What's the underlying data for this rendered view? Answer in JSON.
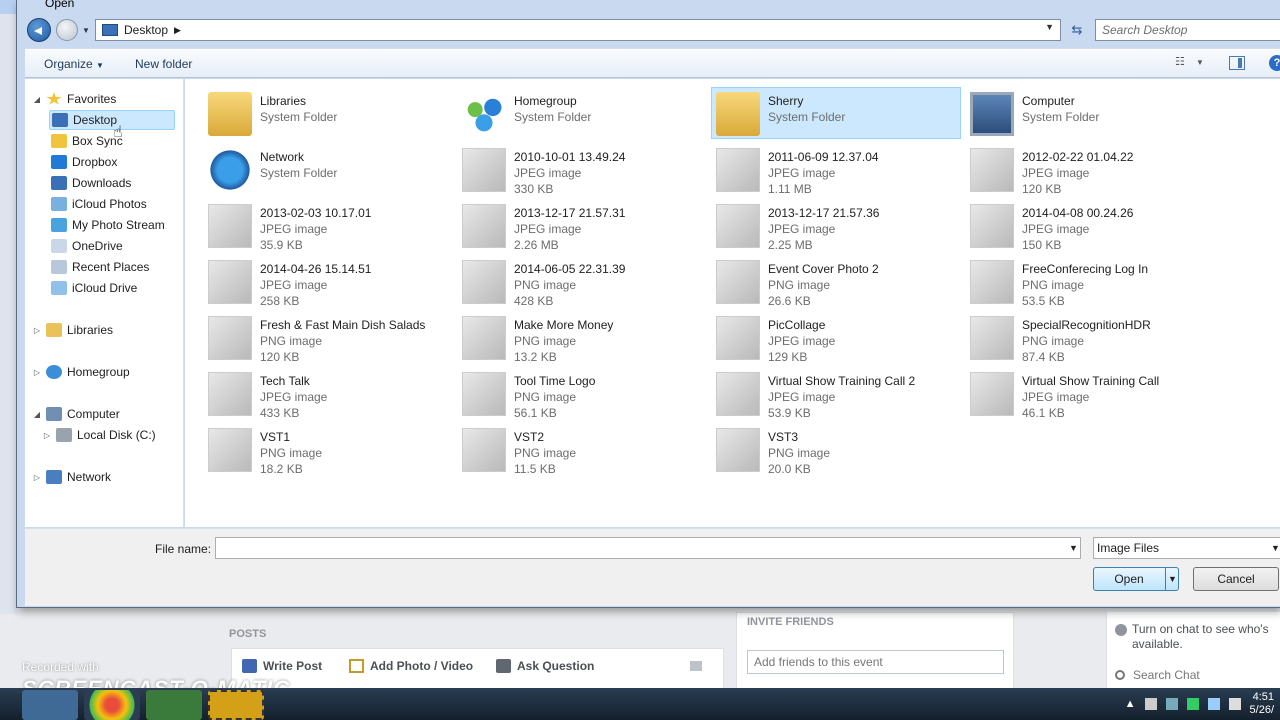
{
  "dialog": {
    "title": "Open",
    "address_path": "Desktop",
    "search_placeholder": "Search Desktop"
  },
  "toolbar": {
    "organize": "Organize",
    "new_folder": "New folder"
  },
  "nav": {
    "favorites": "Favorites",
    "favorite_items": [
      "Desktop",
      "Box Sync",
      "Dropbox",
      "Downloads",
      "iCloud Photos",
      "My Photo Stream",
      "OneDrive",
      "Recent Places",
      "iCloud Drive"
    ],
    "libraries": "Libraries",
    "homegroup": "Homegroup",
    "computer": "Computer",
    "local_disk": "Local Disk (C:)",
    "network": "Network"
  },
  "files": [
    {
      "name": "Libraries",
      "type": "System Folder",
      "size": "",
      "icon": "libraries-icon",
      "selected": false
    },
    {
      "name": "Homegroup",
      "type": "System Folder",
      "size": "",
      "icon": "homegroup-icon",
      "selected": false
    },
    {
      "name": "Sherry",
      "type": "System Folder",
      "size": "",
      "icon": "user-folder-icon",
      "selected": true
    },
    {
      "name": "Computer",
      "type": "System Folder",
      "size": "",
      "icon": "computer-icon",
      "selected": false
    },
    {
      "name": "Network",
      "type": "System Folder",
      "size": "",
      "icon": "network-icon",
      "selected": false
    },
    {
      "name": "2010-10-01 13.49.24",
      "type": "JPEG image",
      "size": "330 KB",
      "icon": "image-thumbnail",
      "selected": false
    },
    {
      "name": "2011-06-09 12.37.04",
      "type": "JPEG image",
      "size": "1.11 MB",
      "icon": "image-thumbnail",
      "selected": false
    },
    {
      "name": "2012-02-22 01.04.22",
      "type": "JPEG image",
      "size": "120 KB",
      "icon": "image-thumbnail",
      "selected": false
    },
    {
      "name": "2013-02-03 10.17.01",
      "type": "JPEG image",
      "size": "35.9 KB",
      "icon": "image-thumbnail",
      "selected": false
    },
    {
      "name": "2013-12-17 21.57.31",
      "type": "JPEG image",
      "size": "2.26 MB",
      "icon": "image-thumbnail",
      "selected": false
    },
    {
      "name": "2013-12-17 21.57.36",
      "type": "JPEG image",
      "size": "2.25 MB",
      "icon": "image-thumbnail",
      "selected": false
    },
    {
      "name": "2014-04-08 00.24.26",
      "type": "JPEG image",
      "size": "150 KB",
      "icon": "image-thumbnail",
      "selected": false
    },
    {
      "name": "2014-04-26 15.14.51",
      "type": "JPEG image",
      "size": "258 KB",
      "icon": "image-thumbnail",
      "selected": false
    },
    {
      "name": "2014-06-05 22.31.39",
      "type": "PNG image",
      "size": "428 KB",
      "icon": "image-thumbnail",
      "selected": false
    },
    {
      "name": "Event Cover Photo 2",
      "type": "PNG image",
      "size": "26.6 KB",
      "icon": "image-thumbnail",
      "selected": false
    },
    {
      "name": "FreeConferecing Log In",
      "type": "PNG image",
      "size": "53.5 KB",
      "icon": "image-thumbnail",
      "selected": false
    },
    {
      "name": "Fresh & Fast Main Dish Salads",
      "type": "PNG image",
      "size": "120 KB",
      "icon": "image-thumbnail",
      "selected": false
    },
    {
      "name": "Make More Money",
      "type": "PNG image",
      "size": "13.2 KB",
      "icon": "image-thumbnail",
      "selected": false
    },
    {
      "name": "PicCollage",
      "type": "JPEG image",
      "size": "129 KB",
      "icon": "image-thumbnail",
      "selected": false
    },
    {
      "name": "SpecialRecognitionHDR",
      "type": "PNG image",
      "size": "87.4 KB",
      "icon": "image-thumbnail",
      "selected": false
    },
    {
      "name": "Tech Talk",
      "type": "JPEG image",
      "size": "433 KB",
      "icon": "image-thumbnail",
      "selected": false
    },
    {
      "name": "Tool Time Logo",
      "type": "PNG image",
      "size": "56.1 KB",
      "icon": "image-thumbnail",
      "selected": false
    },
    {
      "name": "Virtual Show Training Call 2",
      "type": "JPEG image",
      "size": "53.9 KB",
      "icon": "image-thumbnail",
      "selected": false
    },
    {
      "name": "Virtual Show Training Call",
      "type": "JPEG image",
      "size": "46.1 KB",
      "icon": "image-thumbnail",
      "selected": false
    },
    {
      "name": "VST1",
      "type": "PNG image",
      "size": "18.2 KB",
      "icon": "image-thumbnail",
      "selected": false
    },
    {
      "name": "VST2",
      "type": "PNG image",
      "size": "11.5 KB",
      "icon": "image-thumbnail",
      "selected": false
    },
    {
      "name": "VST3",
      "type": "PNG image",
      "size": "20.0 KB",
      "icon": "image-thumbnail",
      "selected": false
    }
  ],
  "bottom": {
    "file_name_label": "File name:",
    "file_name_value": "",
    "filter": "Image Files",
    "open": "Open",
    "cancel": "Cancel"
  },
  "facebook": {
    "posts_label": "POSTS",
    "write_post": "Write Post",
    "add_photo": "Add Photo / Video",
    "ask_question": "Ask Question",
    "invite_title": "INVITE FRIENDS",
    "invite_placeholder": "Add friends to this event",
    "chat_message": "Turn on chat to see who's available.",
    "search_chat": "Search Chat"
  },
  "watermark": {
    "recorded_with": "Recorded with",
    "logo": "SCREENCAST-O-MATIC"
  },
  "taskbar": {
    "time": "4:51",
    "date": "5/26/"
  },
  "colors": {
    "selection": "#cce8ff",
    "selection_border": "#99d1ff",
    "dialog_frame": "#c9daf0",
    "link_blue": "#1e395b"
  }
}
